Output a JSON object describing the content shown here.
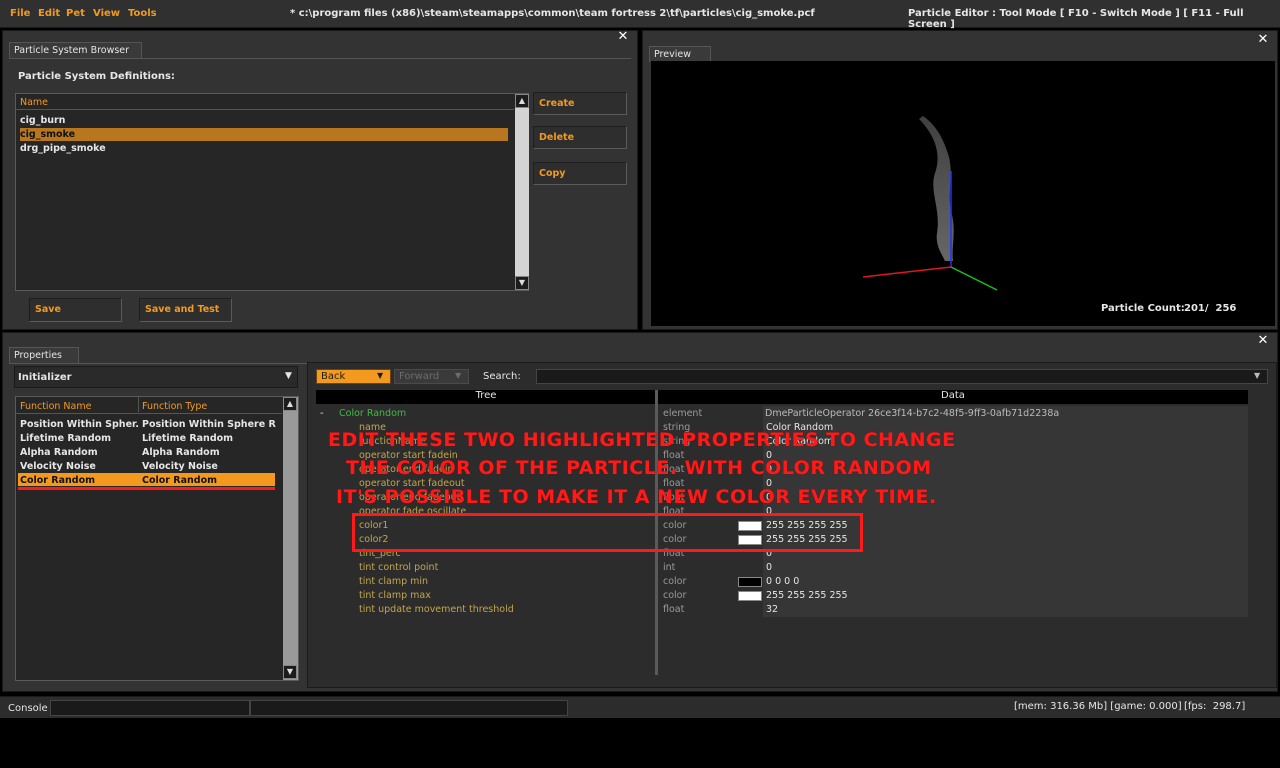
{
  "menu": [
    "File",
    "Edit",
    "Pet",
    "View",
    "Tools"
  ],
  "window_title": "* c:\\program files (x86)\\steam\\steamapps\\common\\team fortress 2\\tf\\particles\\cig_smoke.pcf",
  "mode_label": "Particle Editor  : Tool Mode [ F10 - Switch Mode ] [ F11 - Full Screen ]",
  "browser": {
    "tab": "Particle System Browser",
    "heading": "Particle System Definitions:",
    "column": "Name",
    "items": [
      "cig_burn",
      "cig_smoke",
      "drg_pipe_smoke"
    ],
    "selected": 1,
    "buttons": {
      "create": "Create",
      "delete": "Delete",
      "copy": "Copy",
      "save": "Save",
      "save_test": "Save and Test"
    }
  },
  "preview": {
    "tab": "Preview",
    "count_label": "Particle Count:",
    "count_value": "201/  256"
  },
  "properties": {
    "tab": "Properties",
    "category": "Initializer",
    "col_name": "Function Name",
    "col_type": "Function Type",
    "functions": [
      {
        "name": "Position Within Spher...",
        "type": "Position Within Sphere Ra..."
      },
      {
        "name": "Lifetime Random",
        "type": "Lifetime Random"
      },
      {
        "name": "Alpha Random",
        "type": "Alpha Random"
      },
      {
        "name": "Velocity Noise",
        "type": "Velocity Noise"
      },
      {
        "name": "Color Random",
        "type": "Color Random"
      }
    ],
    "selected": 4,
    "back": "Back",
    "forward": "Forward",
    "search_label": "Search:",
    "tree_header": "Tree",
    "data_header": "Data",
    "root": {
      "name": "Color Random",
      "type": "element",
      "value": "DmeParticleOperator 26ce3f14-b7c2-48f5-9ff3-0afb71d2238a"
    },
    "tree": [
      {
        "name": "name",
        "type": "string",
        "value": "Color Random"
      },
      {
        "name": "functionName",
        "type": "string",
        "value": "Color Random"
      },
      {
        "name": "operator start fadein",
        "type": "float",
        "value": "0"
      },
      {
        "name": "operator end fadein",
        "type": "float",
        "value": "0"
      },
      {
        "name": "operator start fadeout",
        "type": "float",
        "value": "0"
      },
      {
        "name": "operator end fadeout",
        "type": "float",
        "value": "0"
      },
      {
        "name": "operator fade oscillate",
        "type": "float",
        "value": "0"
      },
      {
        "name": "color1",
        "type": "color",
        "value": "255 255 255 255",
        "swatch": "#ffffff"
      },
      {
        "name": "color2",
        "type": "color",
        "value": "255 255 255 255",
        "swatch": "#ffffff"
      },
      {
        "name": "tint_perc",
        "type": "float",
        "value": "0"
      },
      {
        "name": "tint control point",
        "type": "int",
        "value": "0"
      },
      {
        "name": "tint clamp min",
        "type": "color",
        "value": "0 0 0 0",
        "swatch": "#000000"
      },
      {
        "name": "tint clamp max",
        "type": "color",
        "value": "255 255 255 255",
        "swatch": "#ffffff"
      },
      {
        "name": "tint update movement threshold",
        "type": "float",
        "value": "32"
      }
    ]
  },
  "annotation": [
    "EDIT THESE TWO HIGHLIGHTED PROPERTIES TO CHANGE",
    "THE COLOR OF THE PARTICLE. WITH COLOR RANDOM",
    "IT'S POSSIBLE TO MAKE IT A NEW COLOR EVERY TIME."
  ],
  "status": {
    "console": "Console",
    "mem": "[mem: 316.36 Mb] [game: 0.000]",
    "fps": "[fps:  298.7]"
  },
  "colors": {
    "accent": "#f39a1e",
    "selection": "#b8761e",
    "annotation": "#ff1a1a"
  }
}
